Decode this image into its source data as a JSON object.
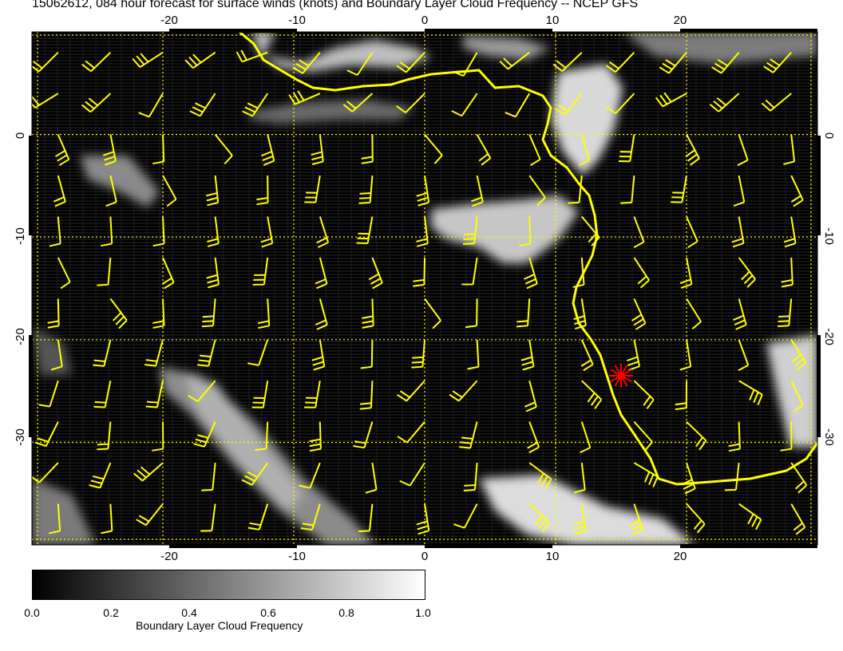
{
  "title": "15062612, 084 hour forecast for surface winds (knots) and Boundary Layer Cloud Frequency -- NCEP GFS",
  "map": {
    "lon_range": [
      -30,
      30
    ],
    "lat_range": [
      -40,
      10
    ],
    "lon_ticks": [
      "-20",
      "-10",
      "0",
      "10",
      "20"
    ],
    "lat_ticks": [
      "0",
      "-10",
      "-20",
      "-30"
    ],
    "coastline_color": "#ffff00",
    "wind_barb_color": "#ffff00",
    "grid_color": "#ffff00",
    "marker": {
      "lon": 15,
      "lat": -23.5,
      "color": "#ff0000",
      "icon": "asterisk-marker-icon"
    }
  },
  "colorbar": {
    "label": "Boundary Layer Cloud Frequency",
    "ticks": [
      "0.0",
      "0.2",
      "0.4",
      "0.6",
      "0.8",
      "1.0"
    ],
    "colors": [
      "#000000",
      "#ffffff"
    ]
  }
}
